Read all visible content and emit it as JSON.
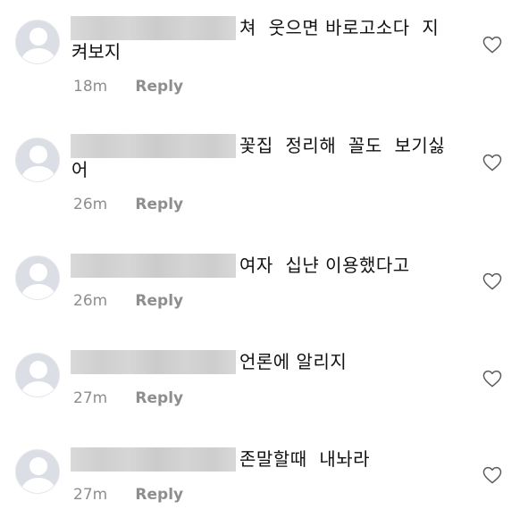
{
  "comments": [
    {
      "text_line1": "쳐  웃으면 바로고소다  지",
      "text_line2": "켜보지",
      "time": "18m",
      "reply": "Reply"
    },
    {
      "text_line1": "꽃집  정리해  꼴도  보기싫",
      "text_line2": "어",
      "time": "26m",
      "reply": "Reply"
    },
    {
      "text_line1": "여자  십냔 이용했다고",
      "text_line2": "",
      "time": "26m",
      "reply": "Reply"
    },
    {
      "text_line1": "언론에 알리지",
      "text_line2": "",
      "time": "27m",
      "reply": "Reply"
    },
    {
      "text_line1": "존말할때  내놔라",
      "text_line2": "",
      "time": "27m",
      "reply": "Reply"
    }
  ],
  "icons": {
    "avatar": "default-user-avatar-icon",
    "like": "heart-outline-icon"
  },
  "colors": {
    "meta": "#8e8e8e",
    "avatar_bg": "#dcdee6",
    "redaction": "#d3d3d3"
  }
}
